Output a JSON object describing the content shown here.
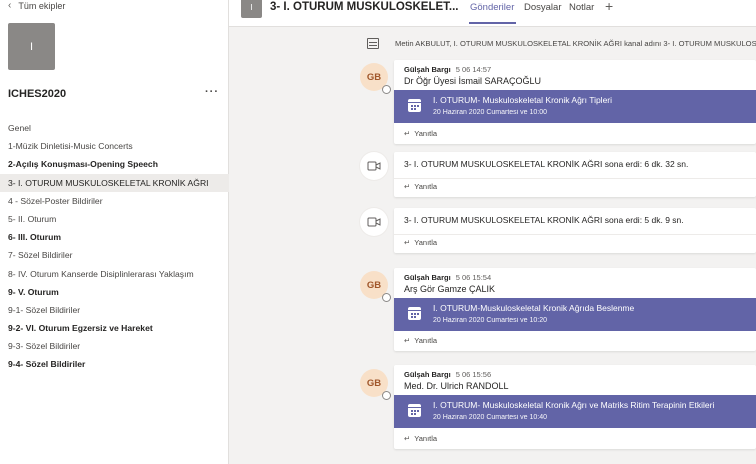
{
  "sidebar": {
    "back_label": "Tüm ekipler",
    "team_avatar_letter": "I",
    "team_name": "ICHES2020",
    "more_label": "···",
    "channels": [
      {
        "label": "Genel",
        "bold": false,
        "active": false
      },
      {
        "label": "1-Müzik Dinletisi-Music Concerts",
        "bold": false,
        "active": false
      },
      {
        "label": "2-Açılış Konuşması-Opening Speech",
        "bold": true,
        "active": false
      },
      {
        "label": "3- I. OTURUM MUSKULOSKELETAL KRONİK AĞRI",
        "bold": false,
        "active": true
      },
      {
        "label": "4 - Sözel-Poster Bildiriler",
        "bold": false,
        "active": false
      },
      {
        "label": "5- II. Oturum",
        "bold": false,
        "active": false
      },
      {
        "label": "6- III. Oturum",
        "bold": true,
        "active": false
      },
      {
        "label": "7- Sözel Bildiriler",
        "bold": false,
        "active": false
      },
      {
        "label": "8- IV. Oturum Kanserde Disiplinlerarası Yaklaşım",
        "bold": false,
        "active": false
      },
      {
        "label": "9- V. Oturum",
        "bold": true,
        "active": false
      },
      {
        "label": "9-1- Sözel Bildiriler",
        "bold": false,
        "active": false
      },
      {
        "label": "9-2- VI. Oturum Egzersiz ve Hareket",
        "bold": true,
        "active": false
      },
      {
        "label": "9-3- Sözel Bildiriler",
        "bold": false,
        "active": false
      },
      {
        "label": "9-4- Sözel Bildiriler",
        "bold": true,
        "active": false
      }
    ]
  },
  "header": {
    "avatar_letter": "I",
    "title": "3- I. OTURUM MUSKULOSKELET...",
    "tabs": [
      {
        "label": "Gönderiler",
        "active": true
      },
      {
        "label": "Dosyalar",
        "active": false
      },
      {
        "label": "Notlar",
        "active": false
      }
    ],
    "add_tab": "+"
  },
  "feed": {
    "system_message": "Metin AKBULUT, I. OTURUM MUSKULOSKELETAL KRONİK AĞRI kanal adını 3- I. OTURUM MUSKULOSK",
    "reply_label": "Yanıtla",
    "posts": [
      {
        "type": "meeting",
        "avatar": "GB",
        "author": "Gülşah Bargı",
        "time": "5 06 14:57",
        "body": "Dr Öğr Üyesi İsmail SARAÇOĞLU",
        "meeting_title": "I. OTURUM- Muskuloskeletal Kronik Ağrı Tipleri",
        "meeting_date": "20 Haziran 2020 Cumartesi ve 10:00"
      },
      {
        "type": "ended",
        "text": "3- I. OTURUM MUSKULOSKELETAL KRONİK AĞRI sona erdi: 6 dk. 32 sn."
      },
      {
        "type": "ended",
        "text": "3- I. OTURUM MUSKULOSKELETAL KRONİK AĞRI sona erdi: 5 dk. 9 sn."
      },
      {
        "type": "meeting",
        "avatar": "GB",
        "author": "Gülşah Bargı",
        "time": "5 06 15:54",
        "body": "Arş Gör Gamze ÇALIK",
        "meeting_title": "I. OTURUM-Muskuloskeletal Kronik Ağrıda Beslenme",
        "meeting_date": "20 Haziran 2020 Cumartesi ve 10:20"
      },
      {
        "type": "meeting",
        "avatar": "GB",
        "author": "Gülşah Bargı",
        "time": "5 06 15:56",
        "body": "Med. Dr. Ulrich RANDOLL",
        "meeting_title": "I. OTURUM- Muskuloskeletal Kronik Ağrı ve Matriks Ritim Terapinin Etkileri",
        "meeting_date": "20 Haziran 2020 Cumartesi ve 10:40"
      }
    ]
  },
  "colors": {
    "accent": "#6264a7",
    "avatar_bg": "#f8e0c8",
    "avatar_text": "#a0562a",
    "sidebar_active": "#edebe9"
  }
}
